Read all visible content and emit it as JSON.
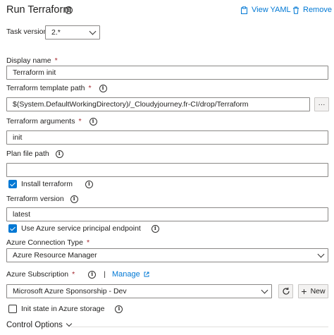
{
  "header": {
    "title": "Run Terraform",
    "view_yaml": "View YAML",
    "remove": "Remove"
  },
  "task_version": {
    "label": "Task version",
    "value": "2.*"
  },
  "display_name": {
    "label": "Display name",
    "required_mark": "*",
    "value": "Terraform init"
  },
  "template_path": {
    "label": "Terraform template path",
    "required_mark": "*",
    "value": "$(System.DefaultWorkingDirectory)/_Cloudyjourney.fr-CI/drop/Terraform",
    "browse": "···"
  },
  "arguments": {
    "label": "Terraform arguments",
    "required_mark": "*",
    "value": "init"
  },
  "plan_file": {
    "label": "Plan file path",
    "value": ""
  },
  "install_terraform": {
    "label": "Install terraform",
    "checked": true
  },
  "terraform_version": {
    "label": "Terraform version",
    "value": "latest"
  },
  "use_spn": {
    "label": "Use Azure service principal endpoint",
    "checked": true
  },
  "connection_type": {
    "label": "Azure Connection Type",
    "required_mark": "*",
    "value": "Azure Resource Manager"
  },
  "subscription": {
    "label": "Azure Subscription",
    "required_mark": "*",
    "separator": "|",
    "manage": "Manage",
    "value": "Microsoft Azure Sponsorship - Dev",
    "new": "New"
  },
  "init_state": {
    "label": "Init state in Azure storage",
    "checked": false
  },
  "control_options": {
    "label": "Control Options"
  },
  "colors": {
    "accent": "#0078d4",
    "text": "#201f1e",
    "border": "#8a8886",
    "required": "#a4262c"
  }
}
